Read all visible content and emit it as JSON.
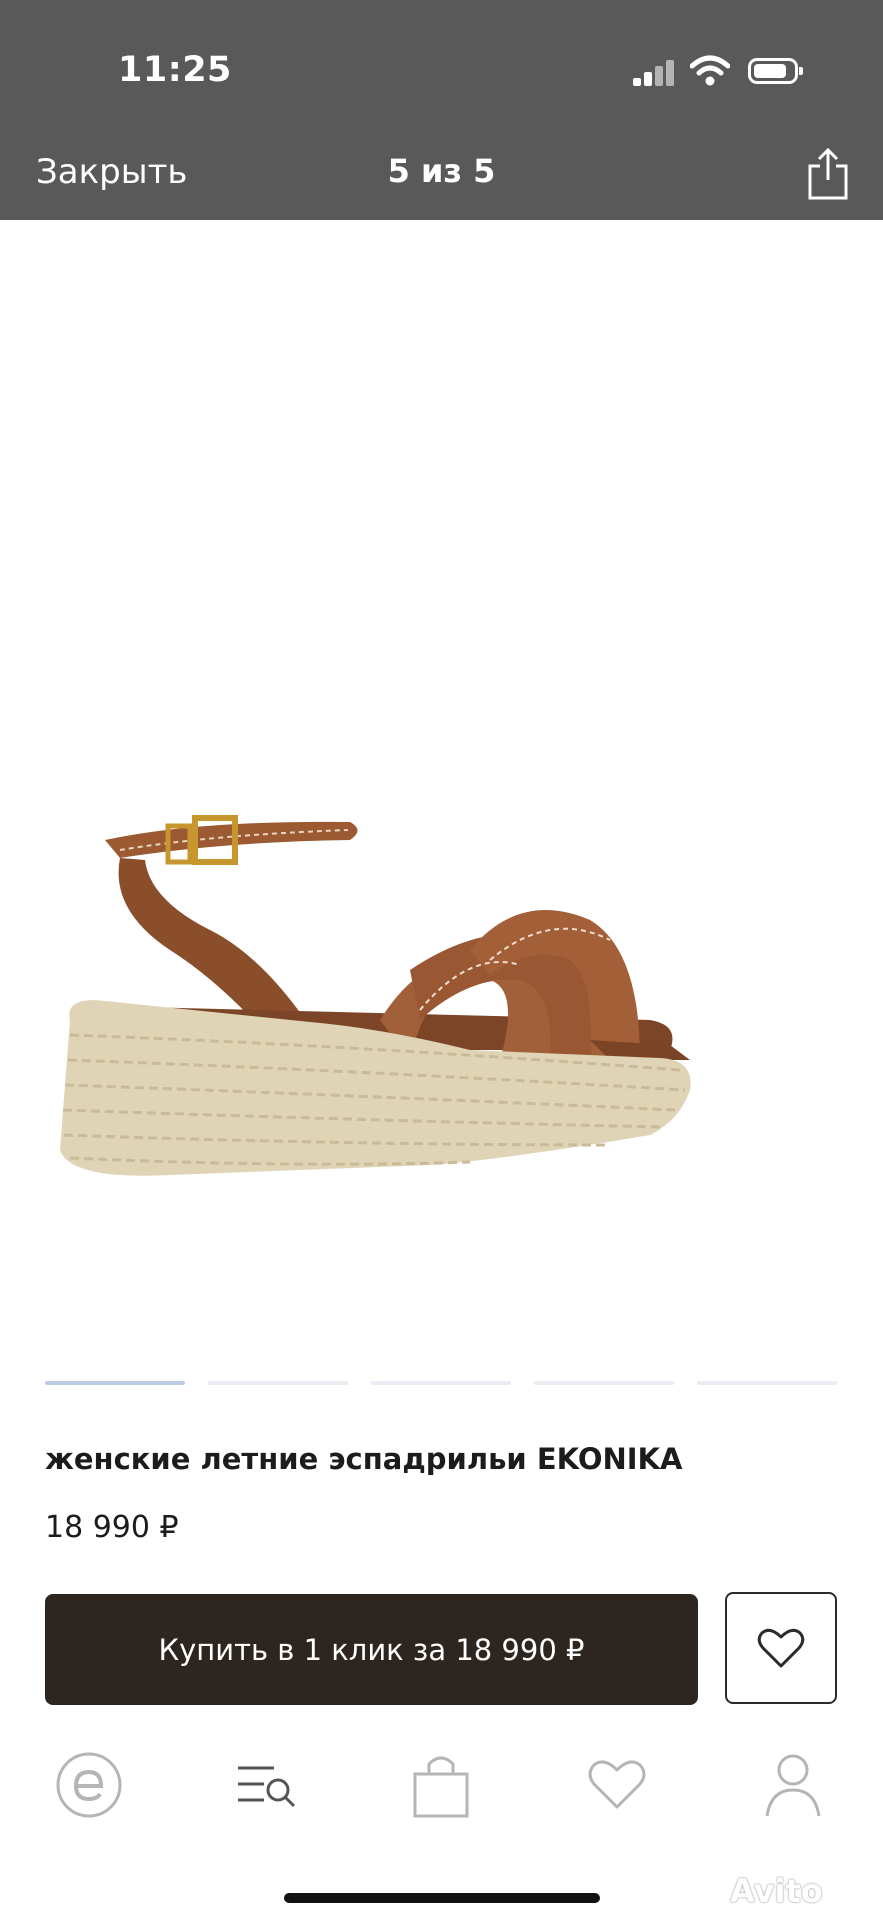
{
  "status_bar": {
    "time": "11:25",
    "icons": [
      "cellular-signal-icon",
      "wifi-icon",
      "battery-icon"
    ]
  },
  "header": {
    "close_label": "Закрыть",
    "counter": "5 из 5",
    "share_icon": "share-icon"
  },
  "gallery": {
    "image_alt": "sandal-product-photo",
    "pages_total": 5,
    "active_page": 1
  },
  "product": {
    "title": "женские летние эспадрильи EKONIKA",
    "price": "18 990 ₽",
    "buy_label": "Купить в 1 клик за 18 990 ₽",
    "favorite_icon": "heart-icon"
  },
  "tabbar": {
    "items": [
      "home-e-icon",
      "catalog-search-icon",
      "cart-bag-icon",
      "favorites-heart-icon",
      "profile-icon"
    ]
  },
  "watermark": "Avito",
  "colors": {
    "header_bg": "#595959",
    "buy_button_bg": "#2d2620",
    "leather": "#9c5a33",
    "jute": "#e0d4b6"
  }
}
